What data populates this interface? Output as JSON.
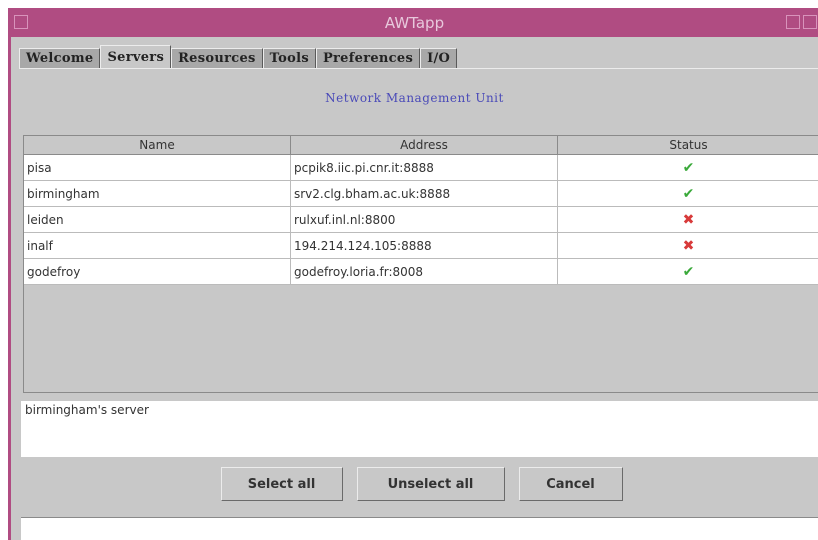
{
  "window": {
    "title": "AWTapp"
  },
  "tabs": [
    {
      "label": "Welcome",
      "active": false
    },
    {
      "label": "Servers",
      "active": true
    },
    {
      "label": "Resources",
      "active": false
    },
    {
      "label": "Tools",
      "active": false
    },
    {
      "label": "Preferences",
      "active": false
    },
    {
      "label": "I/O",
      "active": false
    }
  ],
  "panel": {
    "title": "Network Management Unit"
  },
  "table": {
    "headers": [
      "Name",
      "Address",
      "Status"
    ],
    "rows": [
      {
        "name": "pisa",
        "address": "pcpik8.iic.pi.cnr.it:8888",
        "status": "ok",
        "icon": "check-icon"
      },
      {
        "name": "birmingham",
        "address": "srv2.clg.bham.ac.uk:8888",
        "status": "ok",
        "icon": "check-icon"
      },
      {
        "name": "leiden",
        "address": "rulxuf.inl.nl:8800",
        "status": "error",
        "icon": "cross-icon"
      },
      {
        "name": "inalf",
        "address": "194.214.124.105:8888",
        "status": "error",
        "icon": "cross-icon"
      },
      {
        "name": "godefroy",
        "address": "godefroy.loria.fr:8008",
        "status": "ok",
        "icon": "check-icon"
      }
    ]
  },
  "message": {
    "text": "birmingham's server"
  },
  "buttons": {
    "select_all": "Select all",
    "unselect_all": "Unselect all",
    "cancel": "Cancel"
  },
  "colors": {
    "titlebar": "#b04c82",
    "ok": "#3aa93a",
    "error": "#d83a3a",
    "panel_title": "#4a4ab8"
  }
}
